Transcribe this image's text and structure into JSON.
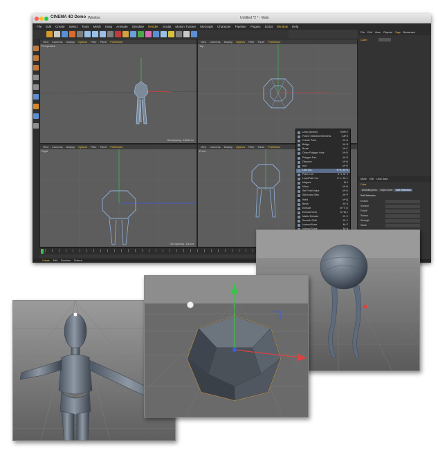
{
  "app": {
    "app_title": "CINEMA 4D Demo",
    "window_label": "Window",
    "doc_title": "Untitled *2 * - Main",
    "menu": [
      "File",
      "Edit",
      "Create",
      "Select",
      "Tools",
      "Mesh",
      "Snap",
      "Animate",
      "Simulate",
      "Render",
      "Sculpt",
      "Motion Tracker",
      "MoGraph",
      "Character",
      "Pipeline",
      "Plugins",
      "Script",
      "Window",
      "Help"
    ],
    "menu_highlight": [
      "Render",
      "Window"
    ],
    "right_menu": [
      "File",
      "Edit",
      "View",
      "Objects",
      "Tags",
      "Bookmark"
    ],
    "object_name": "Cube",
    "viewports": [
      {
        "label": "Perspective",
        "menu": [
          "View",
          "Cameras",
          "Display",
          "Options",
          "Filter",
          "Panel",
          "ProRender"
        ]
      },
      {
        "label": "Top",
        "menu": [
          "View",
          "Cameras",
          "Display",
          "Options",
          "Filter",
          "Panel",
          "ProRender"
        ]
      },
      {
        "label": "Right",
        "menu": [
          "View",
          "Cameras",
          "Display",
          "Options",
          "Filter",
          "Panel",
          "ProRender"
        ]
      },
      {
        "label": "Front",
        "menu": [
          "View",
          "Cameras",
          "Display",
          "Options",
          "Filter",
          "Panel",
          "ProRender"
        ]
      }
    ],
    "grid_spacing_a": "Grid Spacing : 10000 cm",
    "grid_spacing_b": "Grid Spacing : 100 cm",
    "context_menu": [
      {
        "label": "Undo (Action)",
        "shortcut": "Shift+Z"
      },
      {
        "label": "Frame Selected Elements",
        "shortcut": "Alt+S"
      },
      {
        "label": "Create Point",
        "shortcut": "M~A"
      },
      {
        "label": "Bridge",
        "shortcut": "M~B"
      },
      {
        "label": "Brush",
        "shortcut": "M~C"
      },
      {
        "label": "Close Polygon Hole",
        "shortcut": "M~D"
      },
      {
        "label": "Polygon Pen",
        "shortcut": "M~E"
      },
      {
        "label": "Dissolve",
        "shortcut": "M~N"
      },
      {
        "label": "Iron",
        "shortcut": "M~G"
      },
      {
        "label": "Line Cut",
        "shortcut": "K~K, M~K"
      },
      {
        "label": "Plane Cut",
        "shortcut": "K~J, M~J"
      },
      {
        "label": "Loop/Path Cut",
        "shortcut": "K~L, M~L"
      },
      {
        "label": "Magnet",
        "shortcut": "M~I"
      },
      {
        "label": "Mirror",
        "shortcut": "M~H"
      },
      {
        "label": "Set Point Value",
        "shortcut": "M~U"
      },
      {
        "label": "Stitch and Sew",
        "shortcut": "M~P"
      },
      {
        "label": "Weld",
        "shortcut": "M~Q"
      },
      {
        "label": "Bevel",
        "shortcut": "M~S"
      },
      {
        "label": "Extrude",
        "shortcut": "M~T, D"
      },
      {
        "label": "Extrude Inner",
        "shortcut": "M~W, I"
      },
      {
        "label": "Matrix Extrude",
        "shortcut": "M~X"
      },
      {
        "label": "Smooth Shift",
        "shortcut": "M~Y"
      },
      {
        "label": "Normal Move",
        "shortcut": "M~Z"
      },
      {
        "label": "Normal Scale",
        "shortcut": "M~#"
      }
    ],
    "context_highlight_index": 9,
    "attr_menu": [
      "Mode",
      "Edit",
      "User Data"
    ],
    "attr_object": "Cube",
    "attr_tabs": [
      "Modeling Axis",
      "Object Axis",
      "Soft Selection"
    ],
    "attr_section": "Soft Selection",
    "attr_rows": [
      "Enable",
      "Surface",
      "Falloff",
      "Radius",
      "Strength",
      "Width"
    ],
    "bottom_tabs": [
      "Create",
      "Edit",
      "Function",
      "Texture"
    ]
  },
  "colors": {
    "accent": "#f0c33c",
    "menu_highlight_bg": "#5b6f8c",
    "viewport_bg": "#5d5d5d",
    "wire": "#8fb3e0",
    "axis_red": "#e04040",
    "axis_green": "#3cc24a",
    "axis_blue": "#3a5ee0"
  }
}
